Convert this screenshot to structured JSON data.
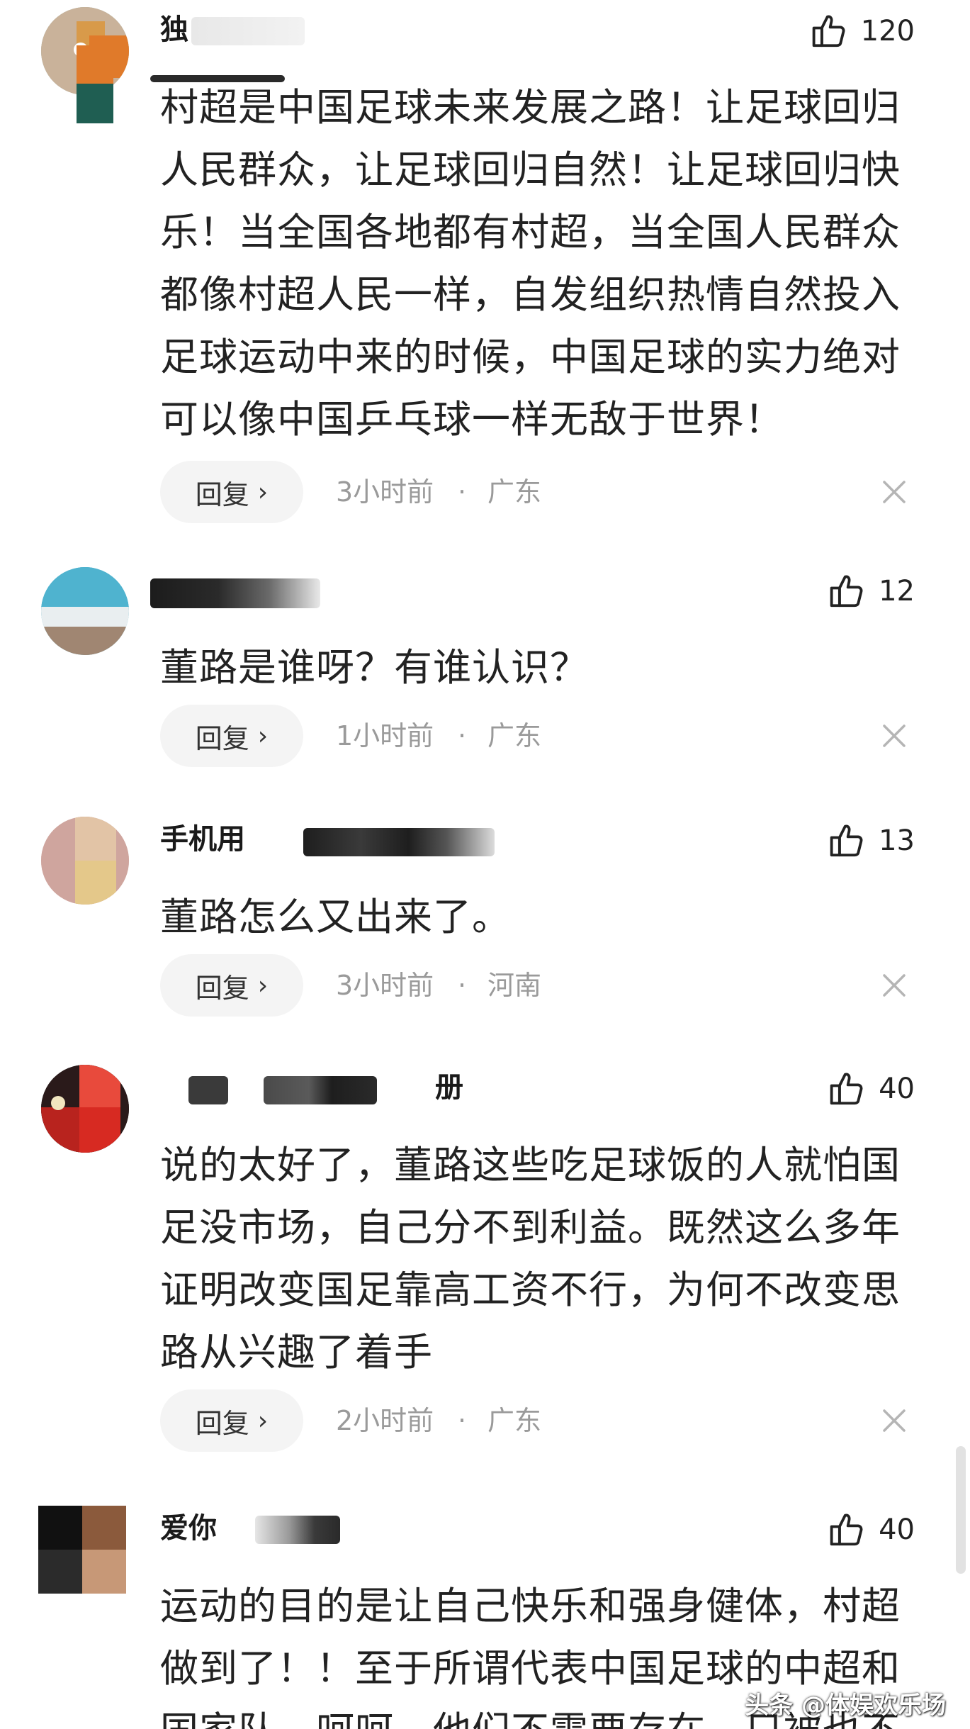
{
  "ui": {
    "reply_label": "回复",
    "reply_chevron": "›",
    "dot": "·",
    "like_icon": "thumbs-up-icon",
    "close_icon": "close-icon"
  },
  "comments": [
    {
      "username": "独",
      "likes": "120",
      "text": "村超是中国足球未来发展之路！让足球回归人民群众，让足球回归自然！让足球回归快乐！当全国各地都有村超，当全国人民群众都像村超人民一样，自发组织热情自然投入足球运动中来的时候，中国足球的实力绝对可以像中国乒乓球一样无敌于世界！",
      "time": "3小时前",
      "location": "广东"
    },
    {
      "username": "",
      "likes": "12",
      "text": "董路是谁呀？有谁认识？",
      "time": "1小时前",
      "location": "广东"
    },
    {
      "username": "手机用",
      "likes": "13",
      "text": "董路怎么又出来了。",
      "time": "3小时前",
      "location": "河南"
    },
    {
      "username": "册",
      "likes": "40",
      "text": "说的太好了，董路这些吃足球饭的人就怕国足没市场，自己分不到利益。既然这么多年证明改变国足靠高工资不行，为何不改变思路从兴趣了着手",
      "time": "2小时前",
      "location": "广东"
    },
    {
      "username": "爱你",
      "likes": "40",
      "text": "运动的目的是让自己快乐和强身健体，村超做到了！！至于所谓代表中国足球的中超和国家队，呵呵，他们不需要存在，只被也不"
    }
  ],
  "watermark": "头条 @体娱欢乐场",
  "colors": {
    "text": "#222222",
    "meta": "#9a9a9a",
    "reply_bg": "#f4f4f4",
    "background": "#ffffff"
  }
}
